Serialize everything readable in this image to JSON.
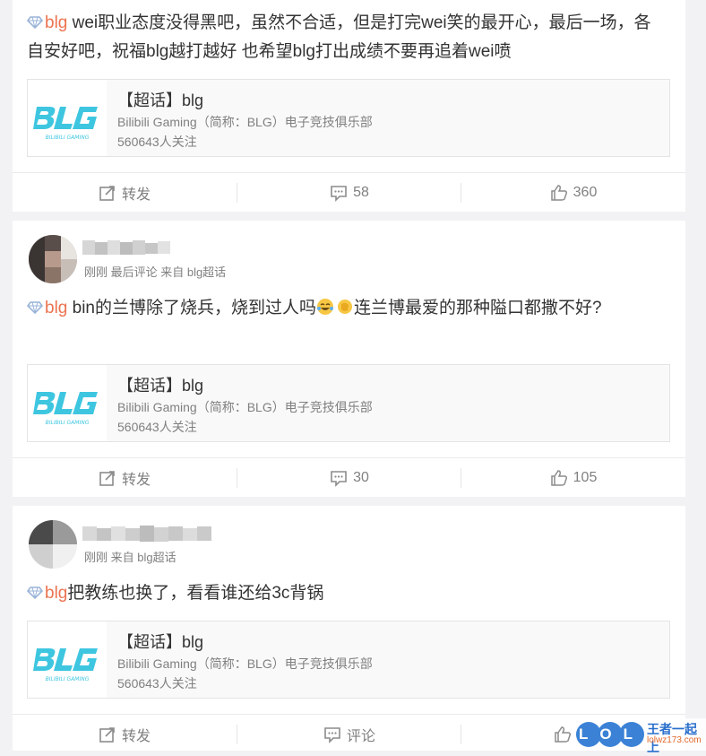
{
  "posts": [
    {
      "topic": "blg",
      "text": " wei职业态度没得黑吧，虽然不合适，但是打完wei笑的最开心，最后一场，各自安好吧，祝福blg越打越好 也希望blg打出成绩不要再追着wei喷",
      "card": {
        "title": "【超话】blg",
        "desc": "Bilibili Gaming（简称：BLG）电子竞技俱乐部",
        "followers": "560643人关注"
      },
      "actions": {
        "repost": "转发",
        "comment": "58",
        "like": "360"
      }
    },
    {
      "meta": "刚刚  最后评论  来自 blg超话",
      "topic": "blg",
      "text": " bin的兰博除了烧兵，烧到过人吗",
      "text2": "连兰博最爱的那种隘口都撒不好?",
      "card": {
        "title": "【超话】blg",
        "desc": "Bilibili Gaming（简称：BLG）电子竞技俱乐部",
        "followers": "560643人关注"
      },
      "actions": {
        "repost": "转发",
        "comment": "30",
        "like": "105"
      }
    },
    {
      "meta": "刚刚  来自 blg超话",
      "topic": "blg",
      "text": "把教练也换了，看看谁还给3c背锅",
      "card": {
        "title": "【超话】blg",
        "desc": "Bilibili Gaming（简称：BLG）电子竞技俱乐部",
        "followers": "560643人关注"
      },
      "actions": {
        "repost": "转发",
        "comment": "评论",
        "like": "赞"
      }
    }
  ],
  "logo_text": "BLG",
  "logo_sub": "BILIBILI GAMING",
  "watermark": {
    "brand": "LOL",
    "site": "王者一起上",
    "url": "lolwz173.com"
  },
  "colors": {
    "accent": "#eb7350",
    "logo": "#3ec6e0"
  }
}
